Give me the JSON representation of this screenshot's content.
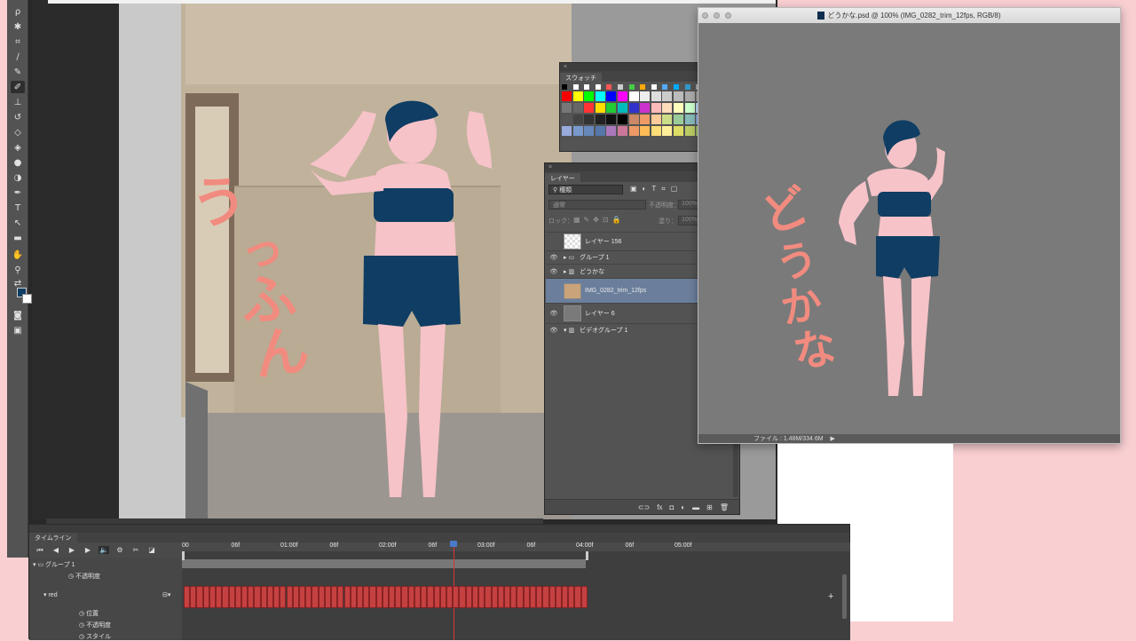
{
  "swatches_panel": {
    "tab": "スウォッチ"
  },
  "layers_panel": {
    "tab": "レイヤー",
    "filter_value": "種類",
    "blend_mode": "通常",
    "opacity_label": "不透明度：",
    "opacity_value": "100%",
    "lock_label": "ロック：",
    "fill_label": "塗り：",
    "fill_value": "100%",
    "layers": [
      {
        "name": "レイヤー 156",
        "visible": false,
        "kind": "pixel"
      },
      {
        "name": "グループ 1",
        "visible": true,
        "kind": "group"
      },
      {
        "name": "どうかな",
        "visible": true,
        "kind": "video-group"
      },
      {
        "name": "IMG_0282_trim_12fps",
        "visible": false,
        "kind": "video",
        "selected": true
      },
      {
        "name": "レイヤー 6",
        "visible": true,
        "kind": "pixel"
      },
      {
        "name": "ビデオグループ 1",
        "visible": true,
        "kind": "video-group"
      }
    ],
    "footer_icons": [
      "link-icon",
      "fx-icon",
      "mask-icon",
      "adjustment-icon",
      "folder-icon",
      "new-layer-icon",
      "trash-icon"
    ]
  },
  "document_window": {
    "title": "どうかな.psd @ 100% (IMG_0282_trim_12fps, RGB/8)",
    "status": "ファイル : 1.48M/334.6M",
    "overlay_text": "どうかな"
  },
  "canvas": {
    "overlay_text": "うっふん"
  },
  "timeline": {
    "tab": "タイムライン",
    "ruler_ticks": [
      "00",
      "06f",
      "01:00f",
      "06f",
      "02:00f",
      "06f",
      "03:00f",
      "06f",
      "04:00f",
      "06f",
      "05:00f"
    ],
    "tracks": [
      {
        "name": "グループ 1",
        "properties": [
          "不透明度"
        ]
      },
      {
        "name": "red",
        "properties": [
          "位置",
          "不透明度",
          "スタイル"
        ]
      }
    ],
    "clip_count": 63
  },
  "colors": {
    "accent_selection": "#6b7f9c",
    "clip_red": "#c54141",
    "pink_text": "#f28b7f",
    "navy": "#0f3d63",
    "skin": "#f6c3c8"
  }
}
